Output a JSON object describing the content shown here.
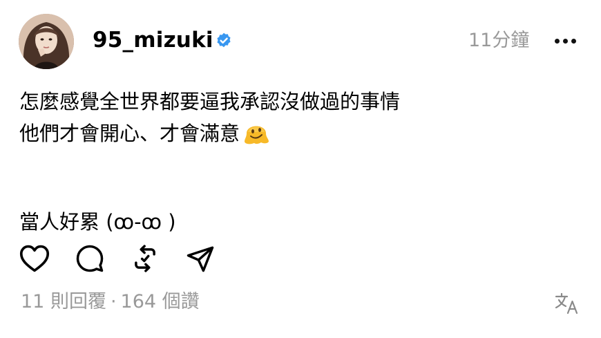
{
  "post": {
    "username": "95_mizuki",
    "timestamp": "11分鐘",
    "lines": [
      "怎麼感覺全世界都要逼我承認沒做過的事情",
      "他們才會開心、才會滿意",
      "當人好累 (ꝏ-ꝏ )"
    ],
    "emoji": "melting-face",
    "replies_label": "11 則回覆",
    "separator": "·",
    "likes_label": "164 個讚"
  },
  "icons": {
    "verified": "verified-badge-icon",
    "more": "more-icon",
    "like": "heart-icon",
    "reply": "comment-icon",
    "repost": "repost-icon",
    "share": "send-icon",
    "translate": "translate-icon"
  },
  "colors": {
    "verified": "#3897f0",
    "muted": "#999999",
    "text": "#000000"
  }
}
